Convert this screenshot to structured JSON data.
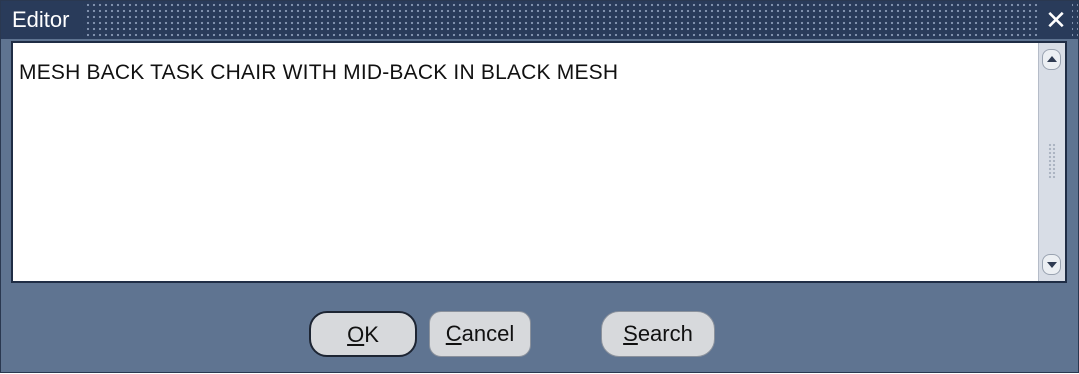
{
  "window": {
    "title": "Editor",
    "close_glyph": "✕"
  },
  "editor": {
    "text": "MESH BACK TASK CHAIR WITH MID-BACK IN BLACK MESH"
  },
  "buttons": {
    "ok": {
      "mnemonic": "O",
      "rest": "K"
    },
    "cancel": {
      "mnemonic": "C",
      "rest": "ancel"
    },
    "search": {
      "mnemonic": "S",
      "rest": "earch"
    }
  },
  "colors": {
    "titlebar": "#293b5a",
    "dialog_bg": "#5f7491",
    "button_bg": "#d7d9dc"
  }
}
